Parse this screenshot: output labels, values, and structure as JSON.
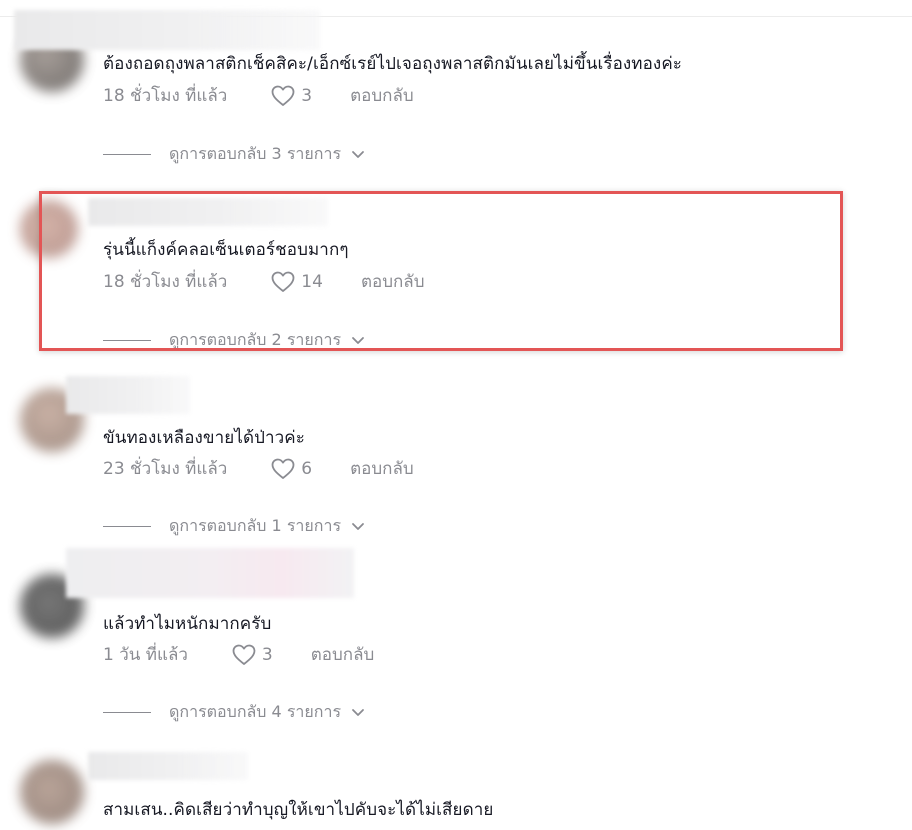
{
  "comments": [
    {
      "text": "ต้องถอดถุงพลาสติกเช็คสิคะ/เอ็กซ์เรย์ไปเจอถุงพลาสติกมันเลยไม่ขึ้นเรื่องทองค่ะ",
      "time": "18 ชั่วโมง ที่แล้ว",
      "likes": "3",
      "reply_label": "ตอบกลับ",
      "view_replies": "ดูการตอบกลับ 3 รายการ"
    },
    {
      "text": "รุ่นนี้แก็งค์คลอเซ็นเตอร์ชอบมากๆ",
      "time": "18 ชั่วโมง ที่แล้ว",
      "likes": "14",
      "reply_label": "ตอบกลับ",
      "view_replies": "ดูการตอบกลับ 2 รายการ"
    },
    {
      "text": "ขันทองเหลืองขายได้ป่าวค่ะ",
      "time": "23 ชั่วโมง ที่แล้ว",
      "likes": "6",
      "reply_label": "ตอบกลับ",
      "view_replies": "ดูการตอบกลับ 1 รายการ"
    },
    {
      "text": "แล้วทำไมหนักมากครับ",
      "time": "1 วัน ที่แล้ว",
      "likes": "3",
      "reply_label": "ตอบกลับ",
      "view_replies": "ดูการตอบกลับ 4 รายการ"
    },
    {
      "text": "สามเสน..คิดเสียว่าทำบุญให้เขาไปคับจะได้ไม่เสียดาย"
    }
  ],
  "colors": {
    "text_primary": "#161823",
    "text_secondary": "#8a8b91",
    "highlight_border": "#e35555"
  },
  "icons": {
    "like": "heart-outline-icon",
    "expand": "chevron-down-icon"
  }
}
